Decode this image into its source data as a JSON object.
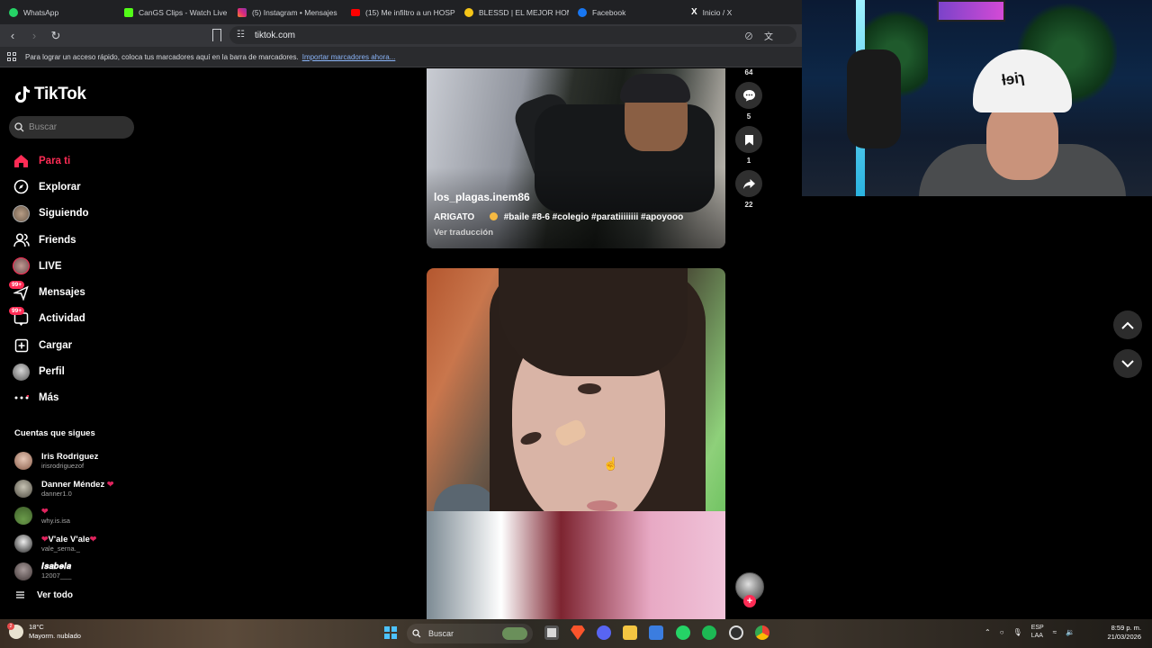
{
  "browser": {
    "tabs": [
      {
        "title": "WhatsApp",
        "color": "#25d366"
      },
      {
        "title": "CanGS Clips - Watch Live",
        "color": "#53fc18"
      },
      {
        "title": "(5) Instagram • Mensajes",
        "color": "#e1306c"
      },
      {
        "title": "(15) Me infiltro a un HOSP",
        "color": "#ff0000"
      },
      {
        "title": "BLESSD | EL MEJOR HOMB",
        "color": "#f5c518"
      },
      {
        "title": "Facebook",
        "color": "#1877f2"
      },
      {
        "title": "Inicio / X",
        "color": "#e7e7e7"
      }
    ],
    "url": "tiktok.com",
    "bookmarks_prompt": "Para lograr un acceso rápido, coloca tus marcadores aquí en la barra de marcadores.",
    "bookmarks_link": "Importar marcadores ahora..."
  },
  "sidebar": {
    "logo": "TikTok",
    "search_placeholder": "Buscar",
    "nav": [
      {
        "label": "Para ti",
        "icon": "home-icon",
        "active": true
      },
      {
        "label": "Explorar",
        "icon": "compass-icon"
      },
      {
        "label": "Siguiendo",
        "icon": "following-avatar-icon"
      },
      {
        "label": "Friends",
        "icon": "friends-icon"
      },
      {
        "label": "LIVE",
        "icon": "live-icon"
      },
      {
        "label": "Mensajes",
        "icon": "messages-icon",
        "badge": "99+"
      },
      {
        "label": "Actividad",
        "icon": "activity-icon",
        "badge": "99+"
      },
      {
        "label": "Cargar",
        "icon": "upload-icon"
      },
      {
        "label": "Perfil",
        "icon": "profile-icon"
      },
      {
        "label": "Más",
        "icon": "more-icon"
      }
    ],
    "following_title": "Cuentas que sigues",
    "following": [
      {
        "name": "Iris Rodriguez",
        "user": "irisrodriguezof",
        "color": "#c9a08a"
      },
      {
        "name": "Danner Méndez",
        "user": "danner1.0",
        "color": "#8a8f84",
        "heart": true
      },
      {
        "name": "",
        "user": "why.is.isa",
        "color": "#6f8f5a",
        "heart": true
      },
      {
        "name": "V'ale V'ale",
        "user": "vale_serna._",
        "color": "#555555",
        "heart": true
      },
      {
        "name": "𝑰𝒔𝒂𝒃𝒆𝒍𝒂",
        "user": "12007___",
        "color": "#7a6a6a"
      }
    ],
    "see_all": "Ver todo"
  },
  "feed": {
    "video1": {
      "username": "los_plagas.inem86",
      "description": "ARIGATO",
      "hashtags": "#baile #8-6 #colegio #paratiiiiiiii #apoyooo",
      "translate": "Ver traducción",
      "likes": "64",
      "comments": "5",
      "saves": "1",
      "shares": "22"
    }
  },
  "taskbar": {
    "temperature": "18°C",
    "weather": "Mayorm. nublado",
    "search": "Buscar",
    "lang1": "ESP",
    "lang2": "LAA",
    "time": "8:59 p. m.",
    "date": "21/03/2026"
  },
  "webcam": {
    "cap_text": "ƚɘiɿ"
  }
}
